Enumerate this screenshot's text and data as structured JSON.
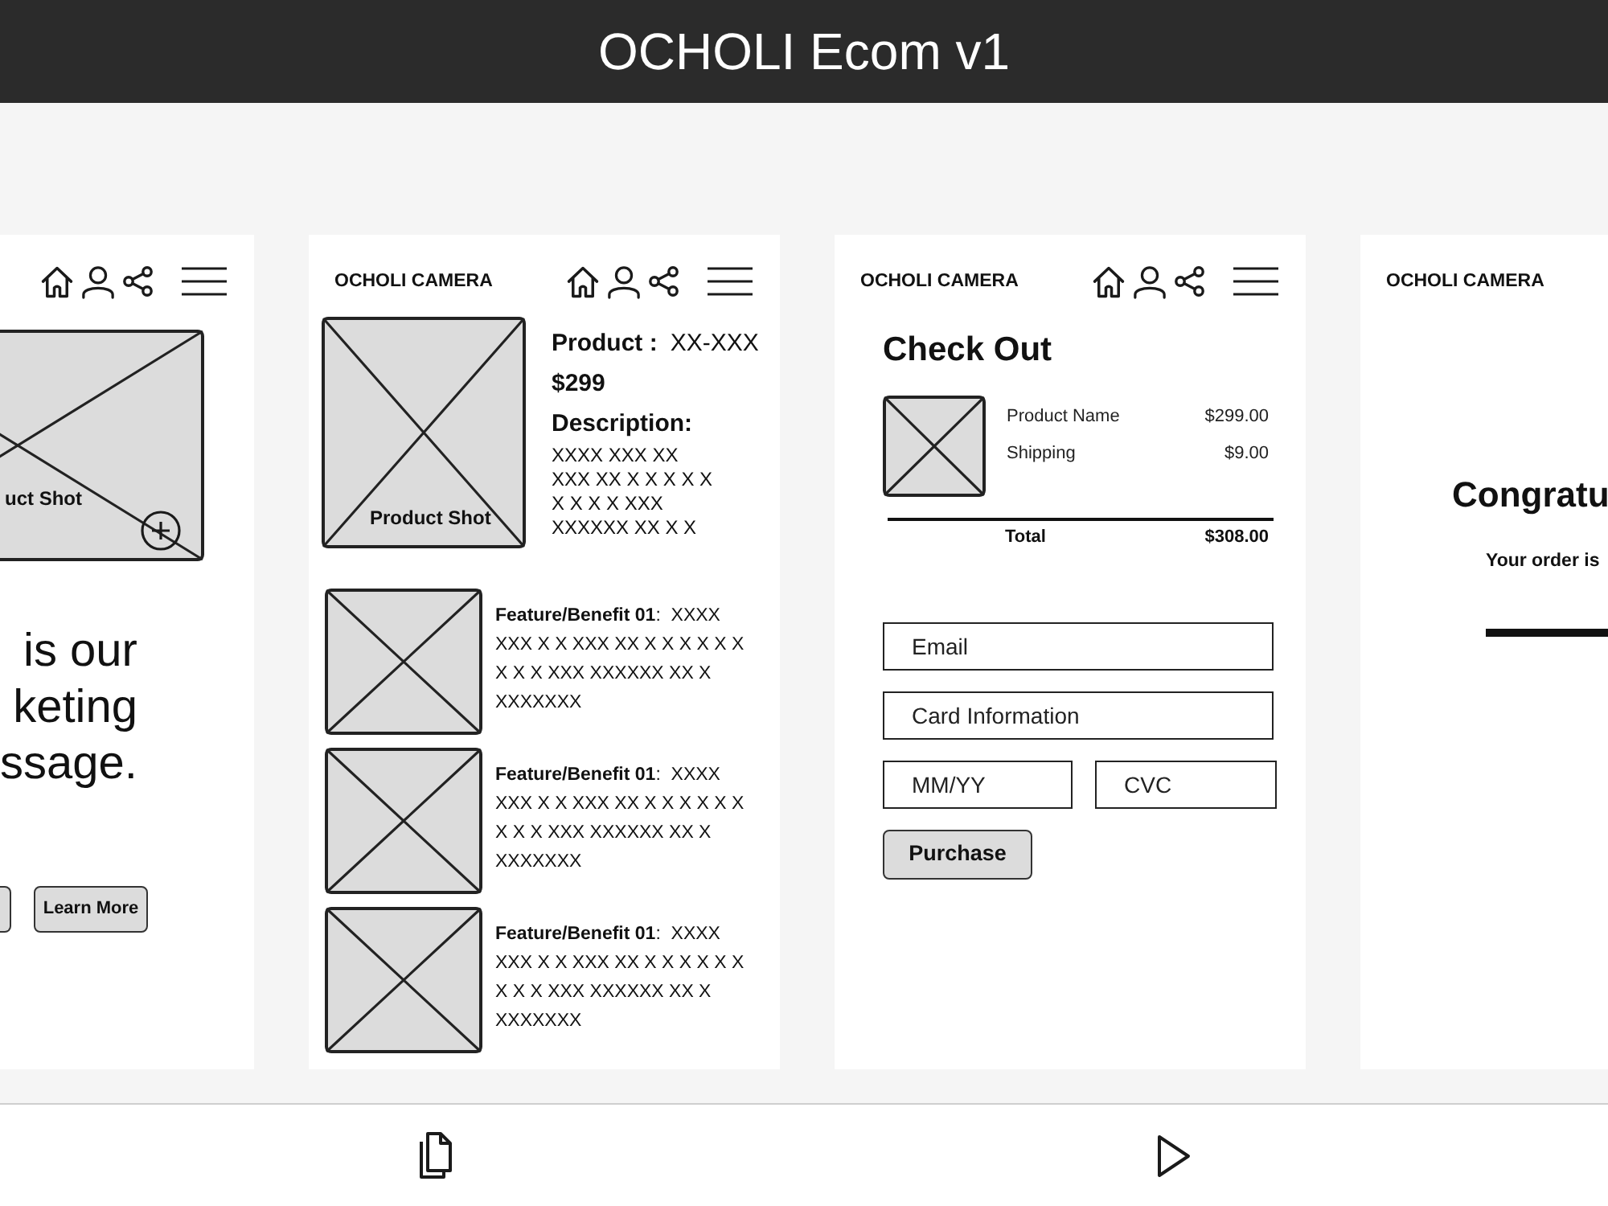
{
  "app_bar": {
    "title": "OCHOLI Ecom v1"
  },
  "screens": [
    {
      "kind": "landing",
      "product_image": {
        "label": "uct Shot"
      },
      "message_lines": [
        "is our",
        "keting",
        "ssage."
      ],
      "button": "Learn More"
    },
    {
      "kind": "product",
      "brand": "OCHOLI CAMERA",
      "product_image": {
        "label": "Product Shot"
      },
      "product_label": "Product :",
      "product_code": "XX-XXX",
      "price": "$299",
      "description_label": "Description:",
      "description_lines": [
        "XXXX XXX XX",
        "XXX XX X X X X X",
        "X X X X XXX",
        "XXXXXX XX X X"
      ],
      "features": [
        {
          "text": "**Feature/Benefit 01**:  XXXX XXX X X XXX XX X X X X X X X X X XXX XXXXXX XX X XXXXXXX"
        },
        {
          "text": "**Feature/Benefit 01**:  XXXX XXX X X XXX XX X X X X X X X X X XXX XXXXXX XX X XXXXXXX"
        },
        {
          "text": "**Feature/Benefit 01**:  XXXX XXX X X XXX XX X X X X X X X X X XXX XXXXXX XX X XXXXXXX"
        }
      ]
    },
    {
      "kind": "checkout",
      "brand": "OCHOLI CAMERA",
      "title": "Check Out",
      "lines": [
        {
          "name": "Product Name",
          "amount": "$299.00"
        },
        {
          "name": "Shipping",
          "amount": "$9.00"
        }
      ],
      "total": {
        "label": "Total",
        "amount": "$308.00"
      },
      "fields": [
        {
          "placeholder": "Email"
        },
        {
          "placeholder": "Card Information"
        },
        {
          "placeholder": "MM/YY"
        },
        {
          "placeholder": "CVC"
        }
      ],
      "button": "Purchase"
    },
    {
      "kind": "confirmation",
      "brand": "OCHOLI CAMERA",
      "title": "Congratu",
      "message": "Your order is"
    }
  ]
}
